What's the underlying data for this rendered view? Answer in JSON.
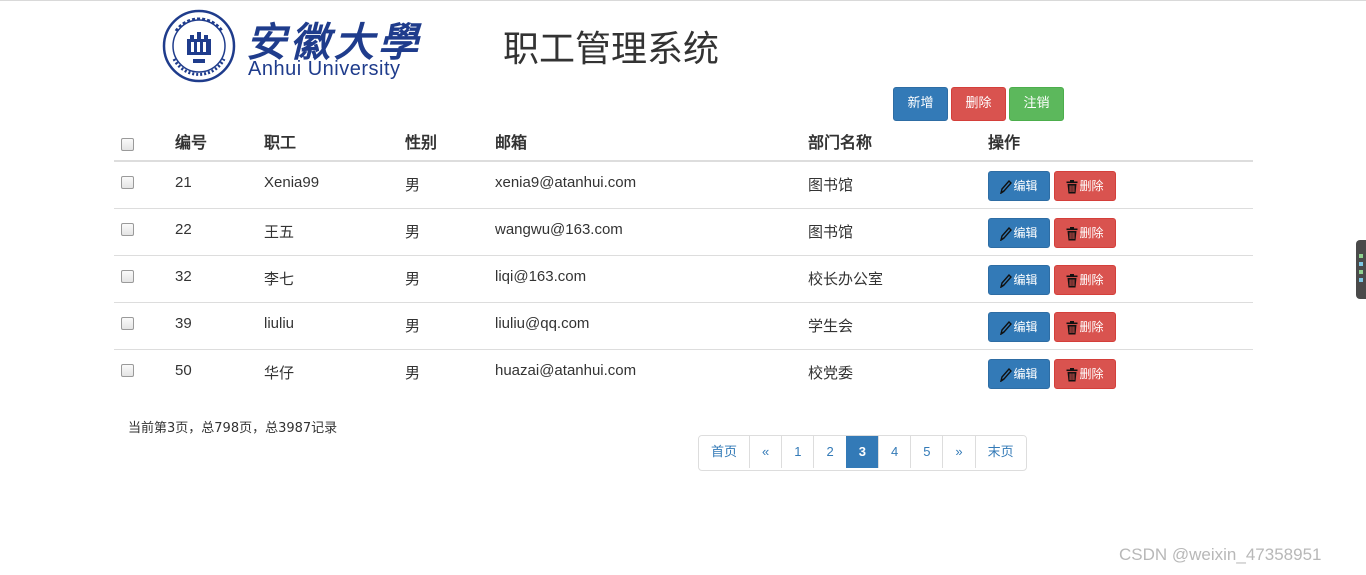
{
  "header": {
    "logo_cn": "安徽大學",
    "logo_en": "Anhui University",
    "title": "职工管理系统"
  },
  "toolbar": {
    "add_label": "新增",
    "delete_label": "删除",
    "logout_label": "注销"
  },
  "table": {
    "columns": [
      "编号",
      "职工",
      "性别",
      "邮箱",
      "部门名称",
      "操作"
    ],
    "rows": [
      {
        "id": "21",
        "name": "Xenia99",
        "gender": "男",
        "email": "xenia9@atanhui.com",
        "dept": "图书馆"
      },
      {
        "id": "22",
        "name": "王五",
        "gender": "男",
        "email": "wangwu@163.com",
        "dept": "图书馆"
      },
      {
        "id": "32",
        "name": "李七",
        "gender": "男",
        "email": "liqi@163.com",
        "dept": "校长办公室"
      },
      {
        "id": "39",
        "name": "liuliu",
        "gender": "男",
        "email": "liuliu@qq.com",
        "dept": "学生会"
      },
      {
        "id": "50",
        "name": "华仔",
        "gender": "男",
        "email": "huazai@atanhui.com",
        "dept": "校党委"
      }
    ],
    "edit_label": "编辑",
    "delete_label": "删除"
  },
  "pagination": {
    "info": "当前第3页，总798页，总3987记录",
    "first": "首页",
    "prev": "«",
    "pages": [
      "1",
      "2",
      "3",
      "4",
      "5"
    ],
    "current": "3",
    "next": "»",
    "last": "末页"
  },
  "colors": {
    "primary": "#337ab7",
    "danger": "#d9534f",
    "success": "#5cb85c",
    "logo_blue": "#1f3c8c"
  },
  "watermark": "CSDN @weixin_47358951"
}
